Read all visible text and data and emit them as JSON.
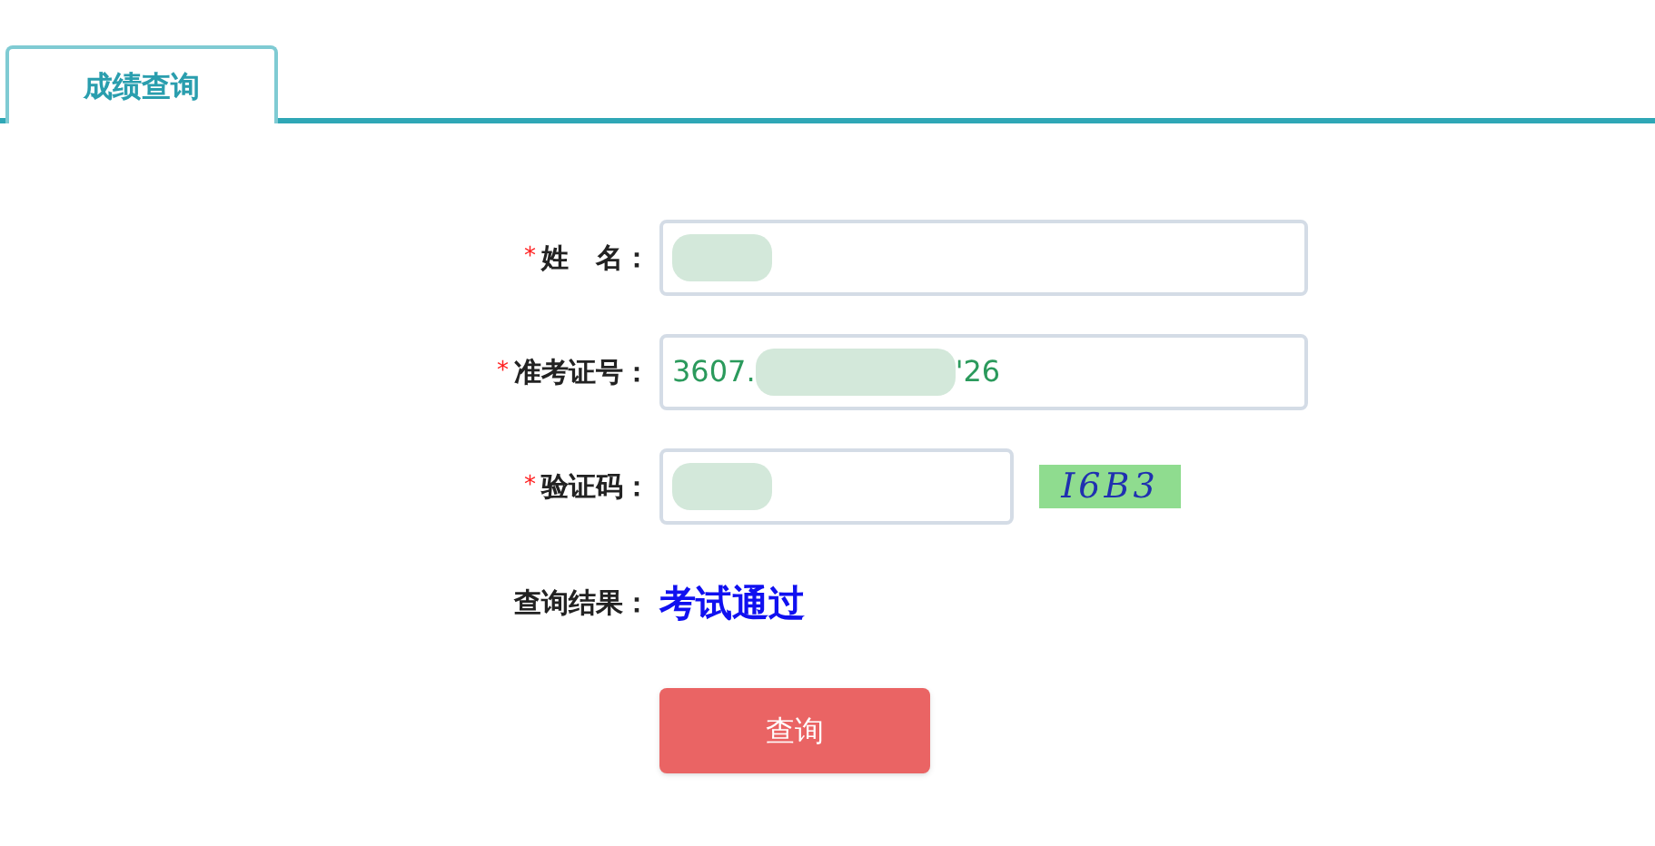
{
  "tabs": [
    {
      "label": "成绩查询",
      "selected": true
    }
  ],
  "form": {
    "fields": [
      {
        "kind": "text",
        "required": true,
        "required_mark": "*",
        "label": "姓　名：",
        "blurred": true
      },
      {
        "kind": "text",
        "required": true,
        "required_mark": "*",
        "label": "准考证号：",
        "value_start": "3607.",
        "value_end": "'26",
        "blurred": true
      },
      {
        "kind": "captcha",
        "required": true,
        "required_mark": "*",
        "label": "验证码：",
        "blurred": true,
        "captcha": "I6B3"
      }
    ],
    "result": {
      "label": "查询结果：",
      "value": "考试通过"
    },
    "submit": "查询"
  }
}
